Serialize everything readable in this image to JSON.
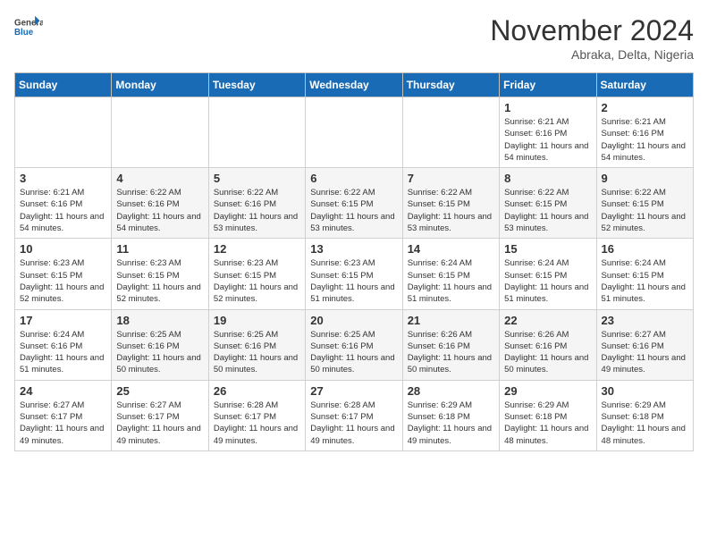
{
  "logo": {
    "line1": "General",
    "line2": "Blue"
  },
  "title": "November 2024",
  "location": "Abraka, Delta, Nigeria",
  "days_of_week": [
    "Sunday",
    "Monday",
    "Tuesday",
    "Wednesday",
    "Thursday",
    "Friday",
    "Saturday"
  ],
  "weeks": [
    [
      {
        "day": "",
        "info": ""
      },
      {
        "day": "",
        "info": ""
      },
      {
        "day": "",
        "info": ""
      },
      {
        "day": "",
        "info": ""
      },
      {
        "day": "",
        "info": ""
      },
      {
        "day": "1",
        "info": "Sunrise: 6:21 AM\nSunset: 6:16 PM\nDaylight: 11 hours and 54 minutes."
      },
      {
        "day": "2",
        "info": "Sunrise: 6:21 AM\nSunset: 6:16 PM\nDaylight: 11 hours and 54 minutes."
      }
    ],
    [
      {
        "day": "3",
        "info": "Sunrise: 6:21 AM\nSunset: 6:16 PM\nDaylight: 11 hours and 54 minutes."
      },
      {
        "day": "4",
        "info": "Sunrise: 6:22 AM\nSunset: 6:16 PM\nDaylight: 11 hours and 54 minutes."
      },
      {
        "day": "5",
        "info": "Sunrise: 6:22 AM\nSunset: 6:16 PM\nDaylight: 11 hours and 53 minutes."
      },
      {
        "day": "6",
        "info": "Sunrise: 6:22 AM\nSunset: 6:15 PM\nDaylight: 11 hours and 53 minutes."
      },
      {
        "day": "7",
        "info": "Sunrise: 6:22 AM\nSunset: 6:15 PM\nDaylight: 11 hours and 53 minutes."
      },
      {
        "day": "8",
        "info": "Sunrise: 6:22 AM\nSunset: 6:15 PM\nDaylight: 11 hours and 53 minutes."
      },
      {
        "day": "9",
        "info": "Sunrise: 6:22 AM\nSunset: 6:15 PM\nDaylight: 11 hours and 52 minutes."
      }
    ],
    [
      {
        "day": "10",
        "info": "Sunrise: 6:23 AM\nSunset: 6:15 PM\nDaylight: 11 hours and 52 minutes."
      },
      {
        "day": "11",
        "info": "Sunrise: 6:23 AM\nSunset: 6:15 PM\nDaylight: 11 hours and 52 minutes."
      },
      {
        "day": "12",
        "info": "Sunrise: 6:23 AM\nSunset: 6:15 PM\nDaylight: 11 hours and 52 minutes."
      },
      {
        "day": "13",
        "info": "Sunrise: 6:23 AM\nSunset: 6:15 PM\nDaylight: 11 hours and 51 minutes."
      },
      {
        "day": "14",
        "info": "Sunrise: 6:24 AM\nSunset: 6:15 PM\nDaylight: 11 hours and 51 minutes."
      },
      {
        "day": "15",
        "info": "Sunrise: 6:24 AM\nSunset: 6:15 PM\nDaylight: 11 hours and 51 minutes."
      },
      {
        "day": "16",
        "info": "Sunrise: 6:24 AM\nSunset: 6:15 PM\nDaylight: 11 hours and 51 minutes."
      }
    ],
    [
      {
        "day": "17",
        "info": "Sunrise: 6:24 AM\nSunset: 6:16 PM\nDaylight: 11 hours and 51 minutes."
      },
      {
        "day": "18",
        "info": "Sunrise: 6:25 AM\nSunset: 6:16 PM\nDaylight: 11 hours and 50 minutes."
      },
      {
        "day": "19",
        "info": "Sunrise: 6:25 AM\nSunset: 6:16 PM\nDaylight: 11 hours and 50 minutes."
      },
      {
        "day": "20",
        "info": "Sunrise: 6:25 AM\nSunset: 6:16 PM\nDaylight: 11 hours and 50 minutes."
      },
      {
        "day": "21",
        "info": "Sunrise: 6:26 AM\nSunset: 6:16 PM\nDaylight: 11 hours and 50 minutes."
      },
      {
        "day": "22",
        "info": "Sunrise: 6:26 AM\nSunset: 6:16 PM\nDaylight: 11 hours and 50 minutes."
      },
      {
        "day": "23",
        "info": "Sunrise: 6:27 AM\nSunset: 6:16 PM\nDaylight: 11 hours and 49 minutes."
      }
    ],
    [
      {
        "day": "24",
        "info": "Sunrise: 6:27 AM\nSunset: 6:17 PM\nDaylight: 11 hours and 49 minutes."
      },
      {
        "day": "25",
        "info": "Sunrise: 6:27 AM\nSunset: 6:17 PM\nDaylight: 11 hours and 49 minutes."
      },
      {
        "day": "26",
        "info": "Sunrise: 6:28 AM\nSunset: 6:17 PM\nDaylight: 11 hours and 49 minutes."
      },
      {
        "day": "27",
        "info": "Sunrise: 6:28 AM\nSunset: 6:17 PM\nDaylight: 11 hours and 49 minutes."
      },
      {
        "day": "28",
        "info": "Sunrise: 6:29 AM\nSunset: 6:18 PM\nDaylight: 11 hours and 49 minutes."
      },
      {
        "day": "29",
        "info": "Sunrise: 6:29 AM\nSunset: 6:18 PM\nDaylight: 11 hours and 48 minutes."
      },
      {
        "day": "30",
        "info": "Sunrise: 6:29 AM\nSunset: 6:18 PM\nDaylight: 11 hours and 48 minutes."
      }
    ]
  ]
}
